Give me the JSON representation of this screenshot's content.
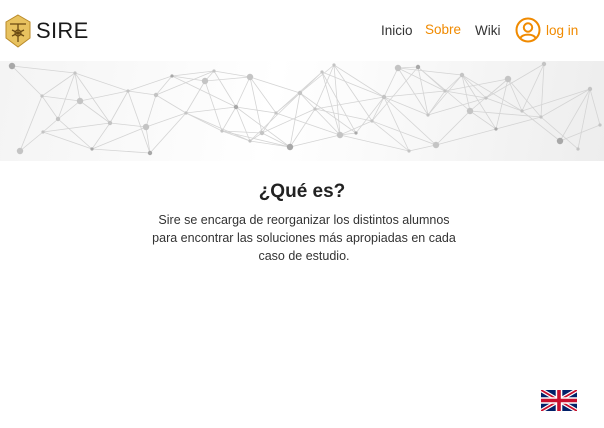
{
  "header": {
    "brand": "SIRE",
    "logo_icon": "sire-logo-icon",
    "nav": {
      "inicio": "Inicio",
      "sobre": "Sobre",
      "wiki": "Wiki"
    },
    "login_label": "log in",
    "login_icon": "user-circle-icon",
    "colors": {
      "accent": "#f08a00",
      "logo_gold": "#e8b84a",
      "text": "#333333"
    }
  },
  "banner": {
    "decoration": "network-graph-pattern"
  },
  "about": {
    "title": "¿Qué es?",
    "text": "Sire se encarga de reorganizar los distintos alumnos para encontrar las soluciones más apropiadas en cada caso de estudio."
  },
  "language_toggle": {
    "icon": "uk-flag-icon"
  }
}
